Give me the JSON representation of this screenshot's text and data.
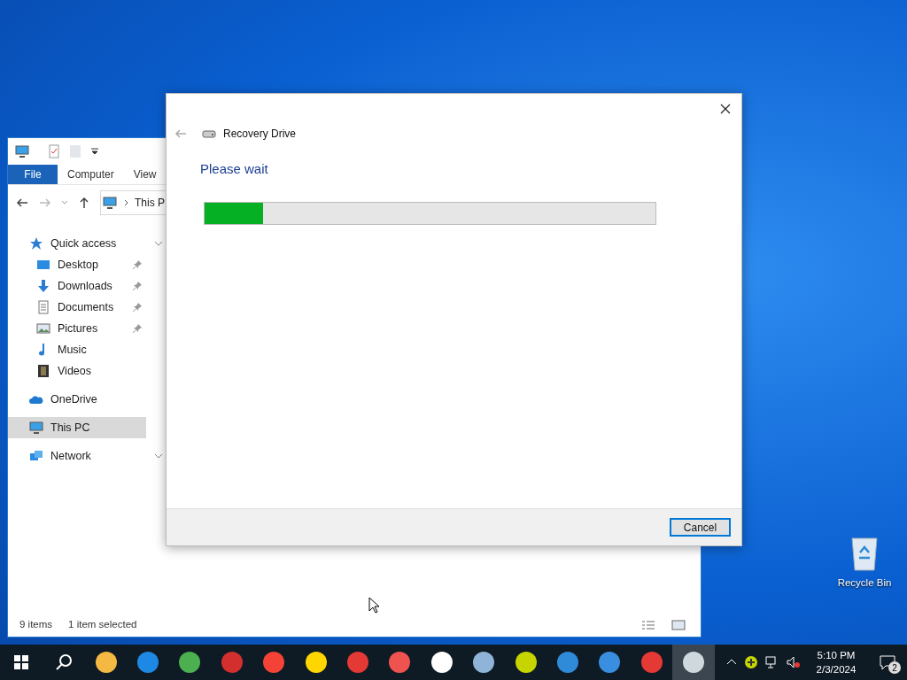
{
  "explorer": {
    "ribbon_tabs": [
      {
        "label": "File",
        "selected": true
      },
      {
        "label": "Computer",
        "selected": false
      },
      {
        "label": "View",
        "selected": false
      }
    ],
    "address": "This P",
    "nav": [
      {
        "label": "Quick access",
        "kind": "star",
        "chevron": true,
        "selected": false,
        "children": [
          {
            "label": "Desktop",
            "kind": "desktop",
            "pinned": true,
            "selected": false
          },
          {
            "label": "Downloads",
            "kind": "download",
            "pinned": true,
            "selected": false
          },
          {
            "label": "Documents",
            "kind": "document",
            "pinned": true,
            "selected": false
          },
          {
            "label": "Pictures",
            "kind": "pictures",
            "pinned": true,
            "selected": false
          },
          {
            "label": "Music",
            "kind": "music",
            "pinned": false,
            "selected": false
          },
          {
            "label": "Videos",
            "kind": "video",
            "pinned": false,
            "selected": false
          }
        ]
      },
      {
        "label": "OneDrive",
        "kind": "cloud",
        "chevron": false,
        "selected": false
      },
      {
        "label": "This PC",
        "kind": "pc",
        "chevron": false,
        "selected": true
      },
      {
        "label": "Network",
        "kind": "network",
        "chevron": true,
        "selected": false
      }
    ],
    "status": [
      "9 items",
      "1 item selected"
    ]
  },
  "dialog": {
    "title": "Recovery Drive",
    "heading": "Please wait",
    "progress": {
      "level": 0.13
    },
    "buttons": [
      "Cancel"
    ]
  },
  "desktop_icons": [
    {
      "label": "Recycle Bin"
    }
  ],
  "taskbar": {
    "apps": [
      {
        "color": "#f4b942",
        "active": false
      },
      {
        "color": "#1e88e5",
        "active": false
      },
      {
        "color": "#4caf50",
        "active": false
      },
      {
        "color": "#d32f2f",
        "active": false
      },
      {
        "color": "#f44336",
        "active": false
      },
      {
        "color": "#ffd600",
        "active": false
      },
      {
        "color": "#e53935",
        "active": false
      },
      {
        "color": "#ef5350",
        "active": false
      },
      {
        "color": "#ffffff",
        "active": false
      },
      {
        "color": "#90b4d8",
        "active": false
      },
      {
        "color": "#c6d400",
        "active": false
      },
      {
        "color": "#2f8ad8",
        "active": false
      },
      {
        "color": "#3a8ee0",
        "active": false
      },
      {
        "color": "#e53935",
        "active": false
      },
      {
        "color": "#cfd8dc",
        "active": true
      }
    ],
    "time": "5:10 PM",
    "date": "2/3/2024",
    "notifications": "2"
  }
}
